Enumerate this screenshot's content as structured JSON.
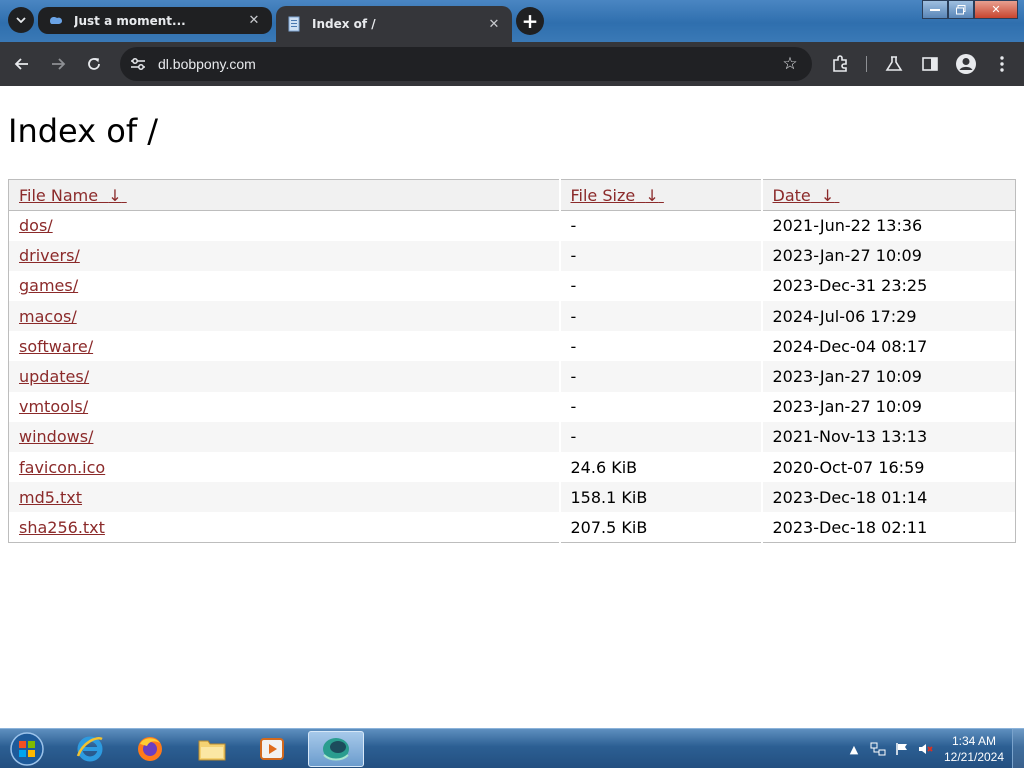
{
  "browser": {
    "tabs": [
      {
        "title": "Just a moment..."
      },
      {
        "title": "Index of /"
      }
    ],
    "address_bar": {
      "url": "dl.bobpony.com"
    },
    "new_tab_label": "+"
  },
  "page": {
    "heading": "Index of /",
    "columns": [
      {
        "label": "File Name",
        "sort_indicator": "↓"
      },
      {
        "label": "File Size",
        "sort_indicator": "↓"
      },
      {
        "label": "Date",
        "sort_indicator": "↓"
      }
    ],
    "rows": [
      {
        "name": "dos/",
        "size": "-",
        "date": "2021-Jun-22 13:36"
      },
      {
        "name": "drivers/",
        "size": "-",
        "date": "2023-Jan-27 10:09"
      },
      {
        "name": "games/",
        "size": "-",
        "date": "2023-Dec-31 23:25"
      },
      {
        "name": "macos/",
        "size": "-",
        "date": "2024-Jul-06 17:29"
      },
      {
        "name": "software/",
        "size": "-",
        "date": "2024-Dec-04 08:17"
      },
      {
        "name": "updates/",
        "size": "-",
        "date": "2023-Jan-27 10:09"
      },
      {
        "name": "vmtools/",
        "size": "-",
        "date": "2023-Jan-27 10:09"
      },
      {
        "name": "windows/",
        "size": "-",
        "date": "2021-Nov-13 13:13"
      },
      {
        "name": "favicon.ico",
        "size": "24.6 KiB",
        "date": "2020-Oct-07 16:59"
      },
      {
        "name": "md5.txt",
        "size": "158.1 KiB",
        "date": "2023-Dec-18 01:14"
      },
      {
        "name": "sha256.txt",
        "size": "207.5 KiB",
        "date": "2023-Dec-18 02:11"
      }
    ]
  },
  "taskbar": {
    "apps": [
      "internet-explorer-icon",
      "firefox-icon",
      "file-explorer-icon",
      "media-player-icon",
      "active-app-icon"
    ],
    "clock": {
      "time": "1:34 AM",
      "date": "12/21/2024"
    }
  },
  "colors": {
    "link": "#8b2a2a",
    "chrome_dark": "#35363a",
    "taskbar": "#2c5f93"
  }
}
